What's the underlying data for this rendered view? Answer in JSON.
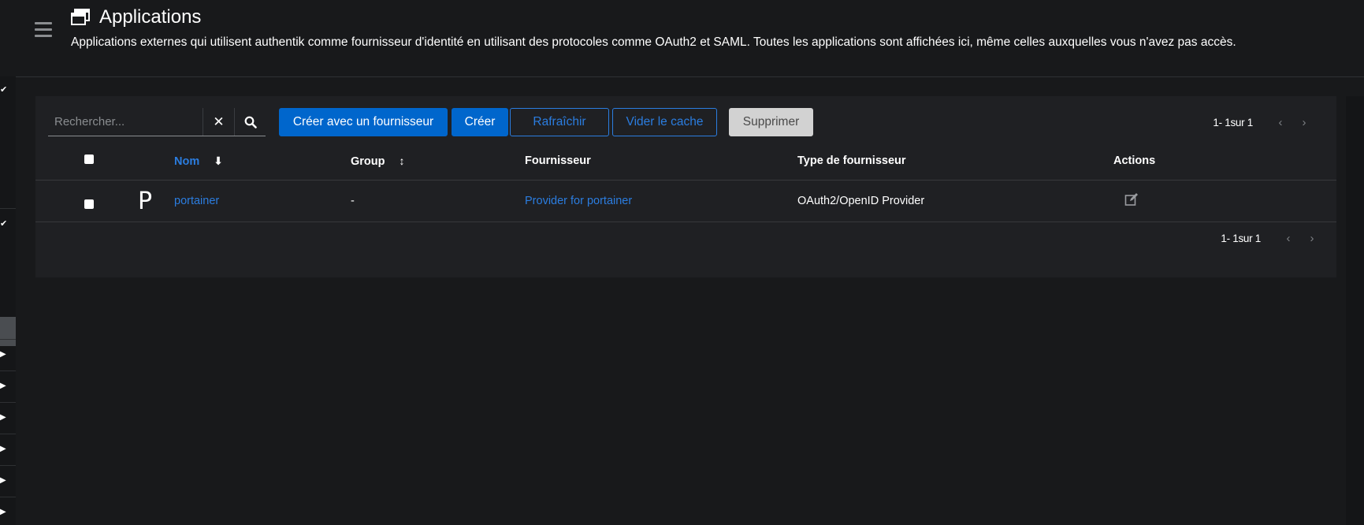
{
  "header": {
    "title": "Applications",
    "description": "Applications externes qui utilisent authentik comme fournisseur d'identité en utilisant des protocoles comme OAuth2 et SAML. Toutes les applications sont affichées ici, même celles auxquelles vous n'avez pas accès.",
    "icon": "application-window-icon"
  },
  "toolbar": {
    "search_placeholder": "Rechercher...",
    "clear_icon": "✕",
    "search_icon": "⌕",
    "create_with_provider": "Créer avec un fournisseur",
    "create": "Créer",
    "refresh": "Rafraîchir",
    "clear_cache": "Vider le cache",
    "delete": "Supprimer"
  },
  "pagination": {
    "text": "1- 1sur 1",
    "prev": "‹",
    "next": "›"
  },
  "table": {
    "columns": {
      "name": "Nom",
      "group": "Group",
      "provider": "Fournisseur",
      "provider_type": "Type de fournisseur",
      "actions": "Actions"
    },
    "rows": [
      {
        "avatar": "P",
        "name": "portainer",
        "group": "-",
        "provider": "Provider for portainer",
        "provider_type": "OAuth2/OpenID Provider"
      }
    ]
  },
  "colors": {
    "accent": "#0066cc",
    "link": "#2b7de0",
    "background": "#18191b",
    "panel": "#1f2023"
  }
}
